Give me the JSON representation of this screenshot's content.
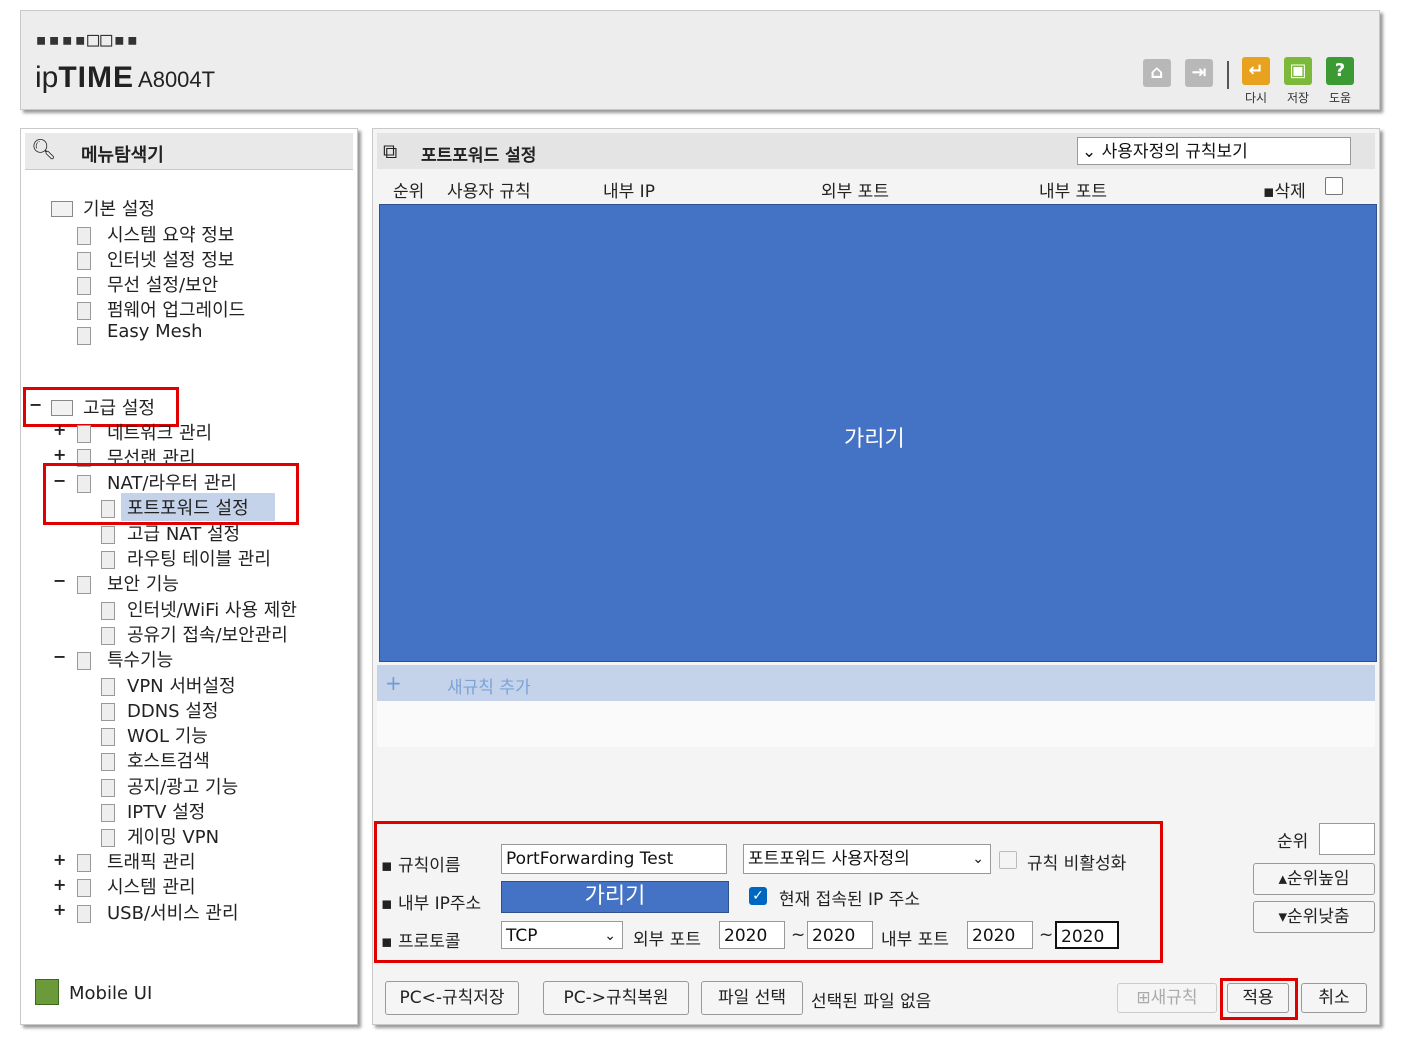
{
  "header": {
    "dot_logo": "▪▪▪▪□□▪▪",
    "brand_prefix": "ip",
    "brand_main": "TIME",
    "model": "A8004T",
    "icons": [
      {
        "name": "home-icon",
        "label": ""
      },
      {
        "name": "logout-icon",
        "label": ""
      },
      {
        "name": "refresh-icon",
        "label": "다시"
      },
      {
        "name": "save-icon",
        "label": "저장"
      },
      {
        "name": "help-icon",
        "label": "도움"
      }
    ]
  },
  "sidebar": {
    "title": "메뉴탐색기",
    "basic": {
      "label": "기본 설정",
      "items": [
        "시스템 요약 정보",
        "인터넷 설정 정보",
        "무선 설정/보안",
        "펌웨어 업그레이드",
        "Easy Mesh"
      ]
    },
    "advanced": {
      "label": "고급 설정",
      "network": "네트워크 관리",
      "wireless": "무선랜 관리",
      "nat": "NAT/라우터 관리",
      "nat_items": [
        "포트포워드 설정",
        "고급 NAT 설정",
        "라우팅 테이블 관리"
      ],
      "security": "보안 기능",
      "security_items": [
        "인터넷/WiFi 사용 제한",
        "공유기 접속/보안관리"
      ],
      "special": "특수기능",
      "special_items": [
        "VPN 서버설정",
        "DDNS 설정",
        "WOL 기능",
        "호스트검색",
        "공지/광고 기능",
        "IPTV 설정",
        "게이밍 VPN"
      ],
      "traffic": "트래픽 관리",
      "system": "시스템 관리",
      "usb": "USB/서비스 관리"
    },
    "mobile_ui": "Mobile UI"
  },
  "main": {
    "title": "포트포워드 설정",
    "view_select": "사용자정의 규칙보기",
    "columns": [
      "순위",
      "사용자 규칙",
      "내부 IP",
      "외부 포트",
      "내부 포트",
      "삭제"
    ],
    "mask_text": "가리기",
    "add_rule": "새규칙 추가",
    "form": {
      "rule_name_label": "규칙이름",
      "rule_name_value": "PortForwarding Test",
      "rule_type": "포트포워드 사용자정의",
      "disable_label": "규칙 비활성화",
      "ip_label": "내부 IP주소",
      "ip_mask": "가리기",
      "current_ip_label": "현재 접속된 IP 주소",
      "protocol_label": "프로토콜",
      "protocol_value": "TCP",
      "ext_port_label": "외부 포트",
      "ext_port_from": "2020",
      "ext_port_to": "2020",
      "int_port_label": "내부 포트",
      "int_port_from": "2020",
      "int_port_to": "2020",
      "tilde": "~"
    },
    "rank": {
      "label": "순위",
      "value": "",
      "up": "순위높임",
      "down": "순위낮춤"
    },
    "buttons": {
      "pc_save": "PC<-규칙저장",
      "pc_restore": "PC->규칙복원",
      "file_select": "파일 선택",
      "no_file": "선택된 파일 없음",
      "new_rule": "새규칙",
      "apply": "적용",
      "cancel": "취소"
    }
  },
  "colors": {
    "mask": "#4472c4",
    "add_row": "#c5d3ea",
    "highlight": "#e00000",
    "selected_item": "#c5d3ea"
  }
}
